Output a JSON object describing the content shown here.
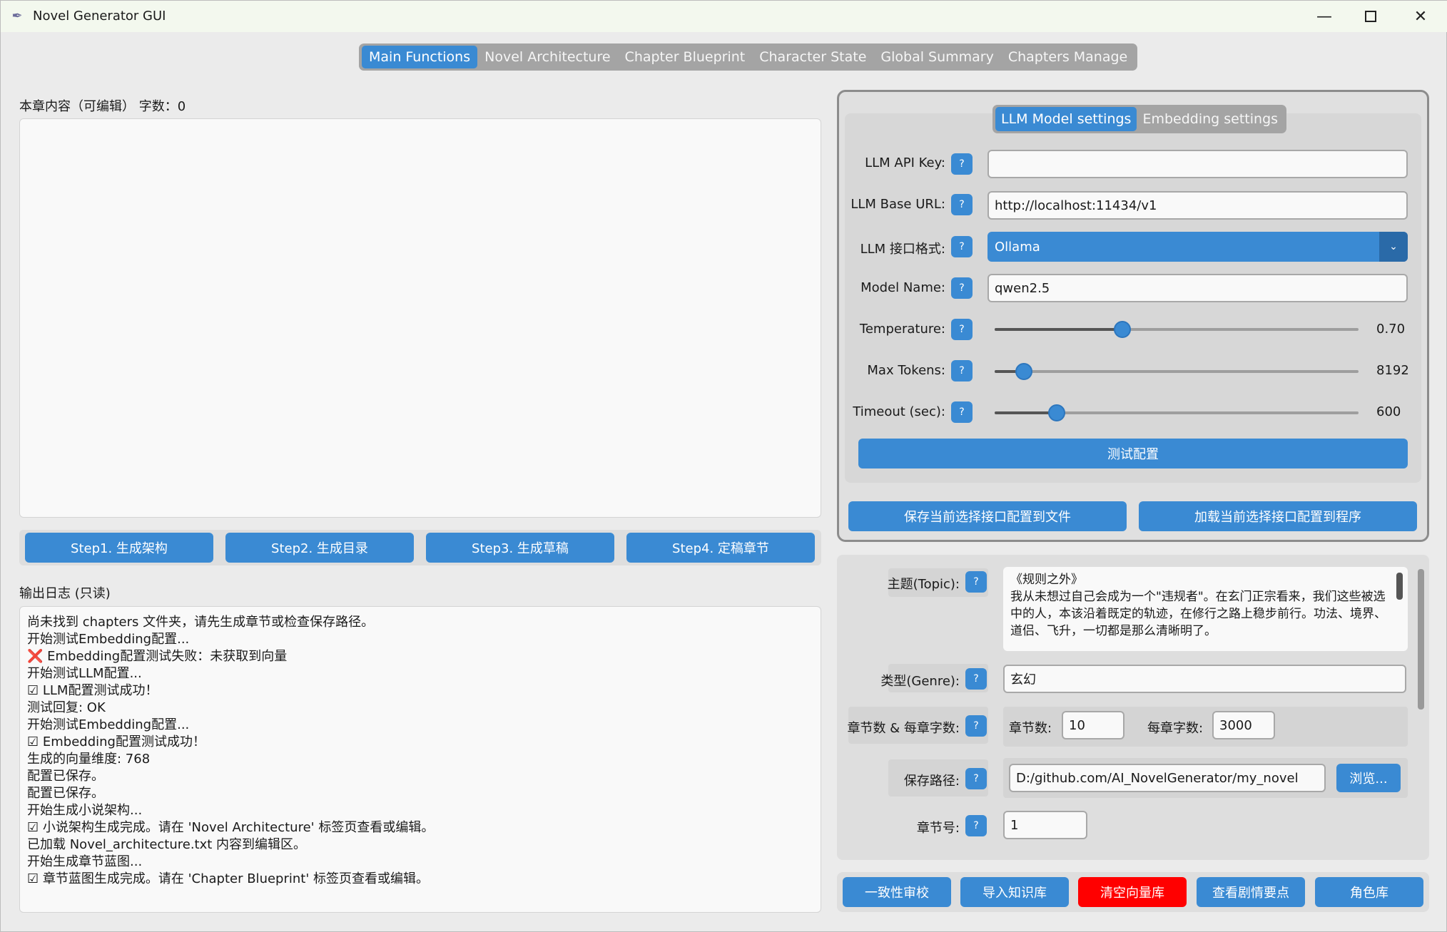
{
  "window": {
    "title": "Novel Generator GUI",
    "icon": "quill-icon",
    "controls": [
      "minimize",
      "maximize",
      "close"
    ]
  },
  "main_tabs": [
    {
      "label": "Main Functions",
      "active": true
    },
    {
      "label": "Novel Architecture",
      "active": false
    },
    {
      "label": "Chapter Blueprint",
      "active": false
    },
    {
      "label": "Character State",
      "active": false
    },
    {
      "label": "Global Summary",
      "active": false
    },
    {
      "label": "Chapters Manage",
      "active": false
    }
  ],
  "editor": {
    "label": "本章内容（可编辑）  字数：0",
    "content": ""
  },
  "steps": [
    "Step1. 生成架构",
    "Step2. 生成目录",
    "Step3. 生成草稿",
    "Step4. 定稿章节"
  ],
  "log": {
    "label": "输出日志 (只读)",
    "lines": [
      "尚未找到 chapters 文件夹，请先生成章节或检查保存路径。",
      "开始测试Embedding配置...",
      "❌ Embedding配置测试失败：未获取到向量",
      "开始测试LLM配置...",
      "☑ LLM配置测试成功！",
      "测试回复: OK",
      "开始测试Embedding配置...",
      "☑ Embedding配置测试成功！",
      "生成的向量维度: 768",
      "配置已保存。",
      "配置已保存。",
      "开始生成小说架构...",
      "☑ 小说架构生成完成。请在 'Novel Architecture' 标签页查看或编辑。",
      "已加载 Novel_architecture.txt 内容到编辑区。",
      "开始生成章节蓝图...",
      "☑ 章节蓝图生成完成。请在 'Chapter Blueprint' 标签页查看或编辑。"
    ]
  },
  "settings": {
    "tabs": [
      {
        "label": "LLM Model settings",
        "active": true
      },
      {
        "label": "Embedding settings",
        "active": false
      }
    ],
    "help_label": "?",
    "fields": {
      "api_key": {
        "label": "LLM API Key:",
        "value": ""
      },
      "base_url": {
        "label": "LLM Base URL:",
        "value": "http://localhost:11434/v1"
      },
      "interface": {
        "label": "LLM 接口格式:",
        "value": "Ollama"
      },
      "model": {
        "label": "Model Name:",
        "value": "qwen2.5"
      }
    },
    "sliders": {
      "temperature": {
        "label": "Temperature:",
        "value": "0.70",
        "fraction": 0.35
      },
      "max_tokens": {
        "label": "Max Tokens:",
        "value": "8192",
        "fraction": 0.08
      },
      "timeout": {
        "label": "Timeout (sec):",
        "value": "600",
        "fraction": 0.17
      }
    },
    "test_button": "测试配置",
    "save_button": "保存当前选择接口配置到文件",
    "load_button": "加载当前选择接口配置到程序"
  },
  "params": {
    "topic": {
      "label": "主题(Topic):",
      "value": "《规则之外》\n我从未想过自己会成为一个\"违规者\"。在玄门正宗看来，我们这些被选中的人，本该沿着既定的轨迹，在修行之路上稳步前行。功法、境界、道侣、飞升，一切都是那么清晰明了。"
    },
    "genre": {
      "label": "类型(Genre):",
      "value": "玄幻"
    },
    "chapters": {
      "label": "章节数 & 每章字数:",
      "num_label": "章节数:",
      "num_value": "10",
      "words_label": "每章字数:",
      "words_value": "3000"
    },
    "path": {
      "label": "保存路径:",
      "value": "D:/github.com/AI_NovelGenerator/my_novel",
      "browse": "浏览..."
    },
    "chapter_no": {
      "label": "章节号:",
      "value": "1"
    }
  },
  "bottom_buttons": [
    {
      "label": "一致性审校",
      "color": "#3a8ad3"
    },
    {
      "label": "导入知识库",
      "color": "#3a8ad3"
    },
    {
      "label": "清空向量库",
      "color": "#ff0000"
    },
    {
      "label": "查看剧情要点",
      "color": "#3a8ad3"
    },
    {
      "label": "角色库",
      "color": "#3a8ad3"
    }
  ],
  "colors": {
    "accent": "#3a8ad3",
    "danger": "#ff0000"
  }
}
